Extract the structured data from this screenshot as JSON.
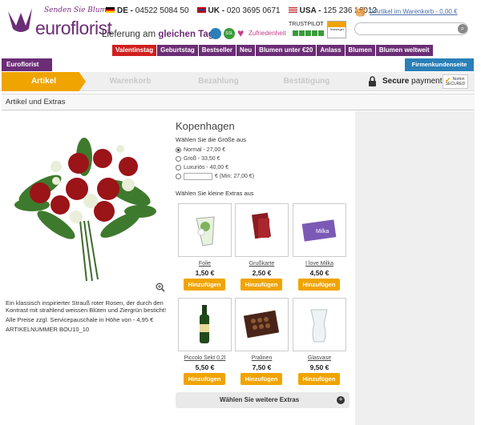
{
  "header": {
    "logo_tagline": "Senden Sie Blumen",
    "logo_text": "euroflorist",
    "phones": [
      {
        "country": "DE",
        "number": "04522 5084 50"
      },
      {
        "country": "UK",
        "number": "020 3695 0671"
      },
      {
        "country": "USA",
        "number": "125 236 26012"
      }
    ],
    "delivery_prefix": "Lieferung am ",
    "delivery_highlight": "gleichen Tag",
    "badge_heart": "Zufriedenheit",
    "badge_ssl": "SSL",
    "trustpilot": "TRUSTPILOT",
    "jury_badge": "Testsieger",
    "cart_text": "0 Artikel im Warenkorb - 0,00 €"
  },
  "nav": {
    "items": [
      "Valentinstag",
      "Geburtstag",
      "Bestseller",
      "Neu",
      "Blumen unter €20",
      "Anlass",
      "Blumen",
      "Blumen weltweit"
    ]
  },
  "tabs": {
    "left": "Euroflorist",
    "right": "Firmenkundenseite"
  },
  "steps": [
    "Artikel",
    "Warenkorb",
    "Bezahlung",
    "Bestätigung"
  ],
  "secure": {
    "bold": "Secure",
    "rest": " payment",
    "norton": "Norton SECURED"
  },
  "section_title": "Artikel und Extras",
  "product": {
    "title": "Kopenhagen",
    "size_label": "Wählen Sie die Größe aus",
    "sizes": [
      "Normal - 27,00 €",
      "Groß - 33,50 €",
      "Luxuriös - 40,00 €"
    ],
    "custom_size": "€ (Min: 27,00 €)",
    "extras_label": "Wählen Sie kleine Extras aus",
    "description": "Ein klassisch inspirierter Strauß roter Rosen, der durch den Kontrast mit strahlend weissen Blüten und Ziergrün besticht!",
    "service_fee": "Alle Preise zzgl. Servicepauschale in Höhe von - 4,95 €",
    "article_number": "ARTIKELNUMMER BOU10_10"
  },
  "extras": [
    {
      "name": "Folie",
      "price": "1,50 €"
    },
    {
      "name": "Grußkarte",
      "price": "2,50 €"
    },
    {
      "name": "I love Milka",
      "price": "4,50 €"
    },
    {
      "name": "Piccolo Sekt 0,2l",
      "price": "5,50 €"
    },
    {
      "name": "Pralinen",
      "price": "7,50 €"
    },
    {
      "name": "Glasvase",
      "price": "9,50 €"
    }
  ],
  "add_label": "Hinzufügen",
  "more_extras": "Wählen Sie weitere Extras",
  "colors": {
    "brand": "#6b2d75",
    "accent": "#f0a400",
    "hot": "#d11f1f",
    "blue": "#2a7fb8"
  }
}
